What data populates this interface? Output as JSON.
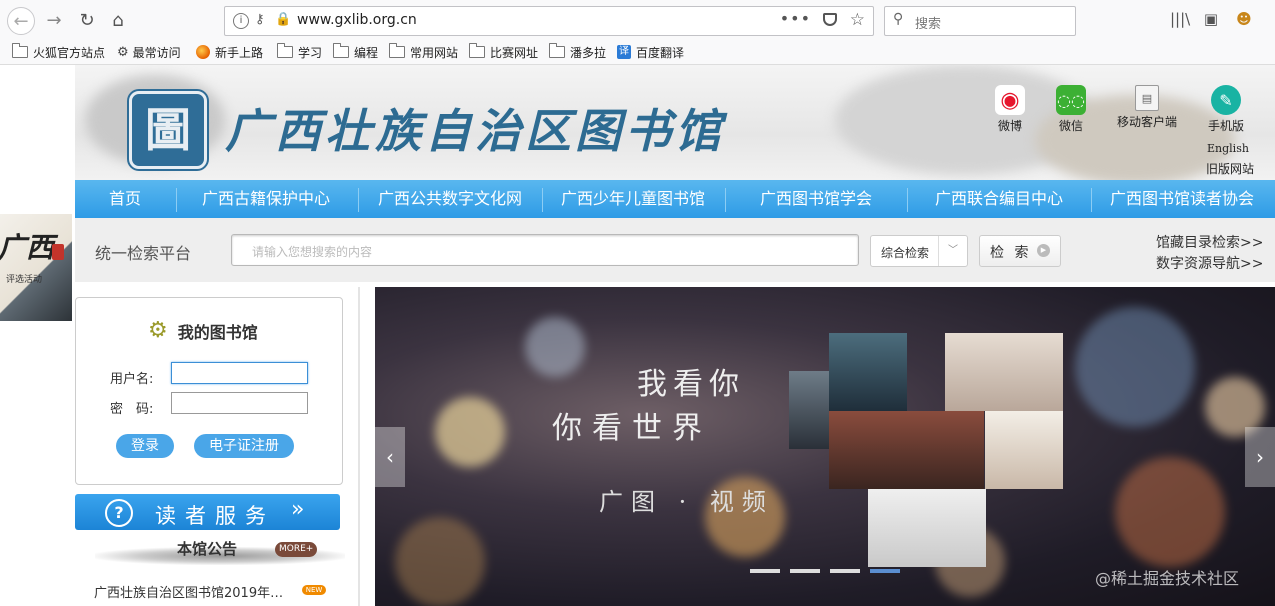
{
  "browser": {
    "url": "www.gxlib.org.cn",
    "search_placeholder": "搜索",
    "bookmarks": [
      "火狐官方站点",
      "最常访问",
      "新手上路",
      "学习",
      "编程",
      "常用网站",
      "比赛网址",
      "潘多拉",
      "百度翻译"
    ]
  },
  "header": {
    "seal_char": "圖",
    "title": "广西壮族自治区图书馆",
    "social": [
      {
        "label": "微博",
        "color": "#e6162d"
      },
      {
        "label": "微信",
        "color": "#3cb034"
      },
      {
        "label": "移动客户端",
        "color": "#eeeeee"
      },
      {
        "label": "手机版",
        "color": "#19b3a3"
      }
    ],
    "english": "English",
    "old_site": "旧版网站"
  },
  "nav": [
    "首页",
    "广西古籍保护中心",
    "广西公共数字文化网",
    "广西少年儿童图书馆",
    "广西图书馆学会",
    "广西联合编目中心",
    "广西图书馆读者协会"
  ],
  "search": {
    "label": "统一检索平台",
    "placeholder": "请输入您想搜索的内容",
    "select_value": "综合检索",
    "button": "检 索",
    "links": [
      "馆藏目录检索>>",
      "数字资源导航>>"
    ]
  },
  "side_ad": {
    "title": "广西",
    "caption": "评选活动"
  },
  "login": {
    "title": "我的图书馆",
    "username_label": "用户名:",
    "password_label": "密　码:",
    "login_btn": "登录",
    "register_btn": "电子证注册"
  },
  "reader_service": "读者服务",
  "notice": {
    "title": "本馆公告",
    "more": "MORE+",
    "item": "广西壮族自治区图书馆2019年…",
    "new_badge": "NEW"
  },
  "banner": {
    "line1": "我看你",
    "line2": "你看世界",
    "line3": "广图 · 视频",
    "slides": 4,
    "active_slide": 4
  },
  "watermark": "@稀土掘金技术社区"
}
